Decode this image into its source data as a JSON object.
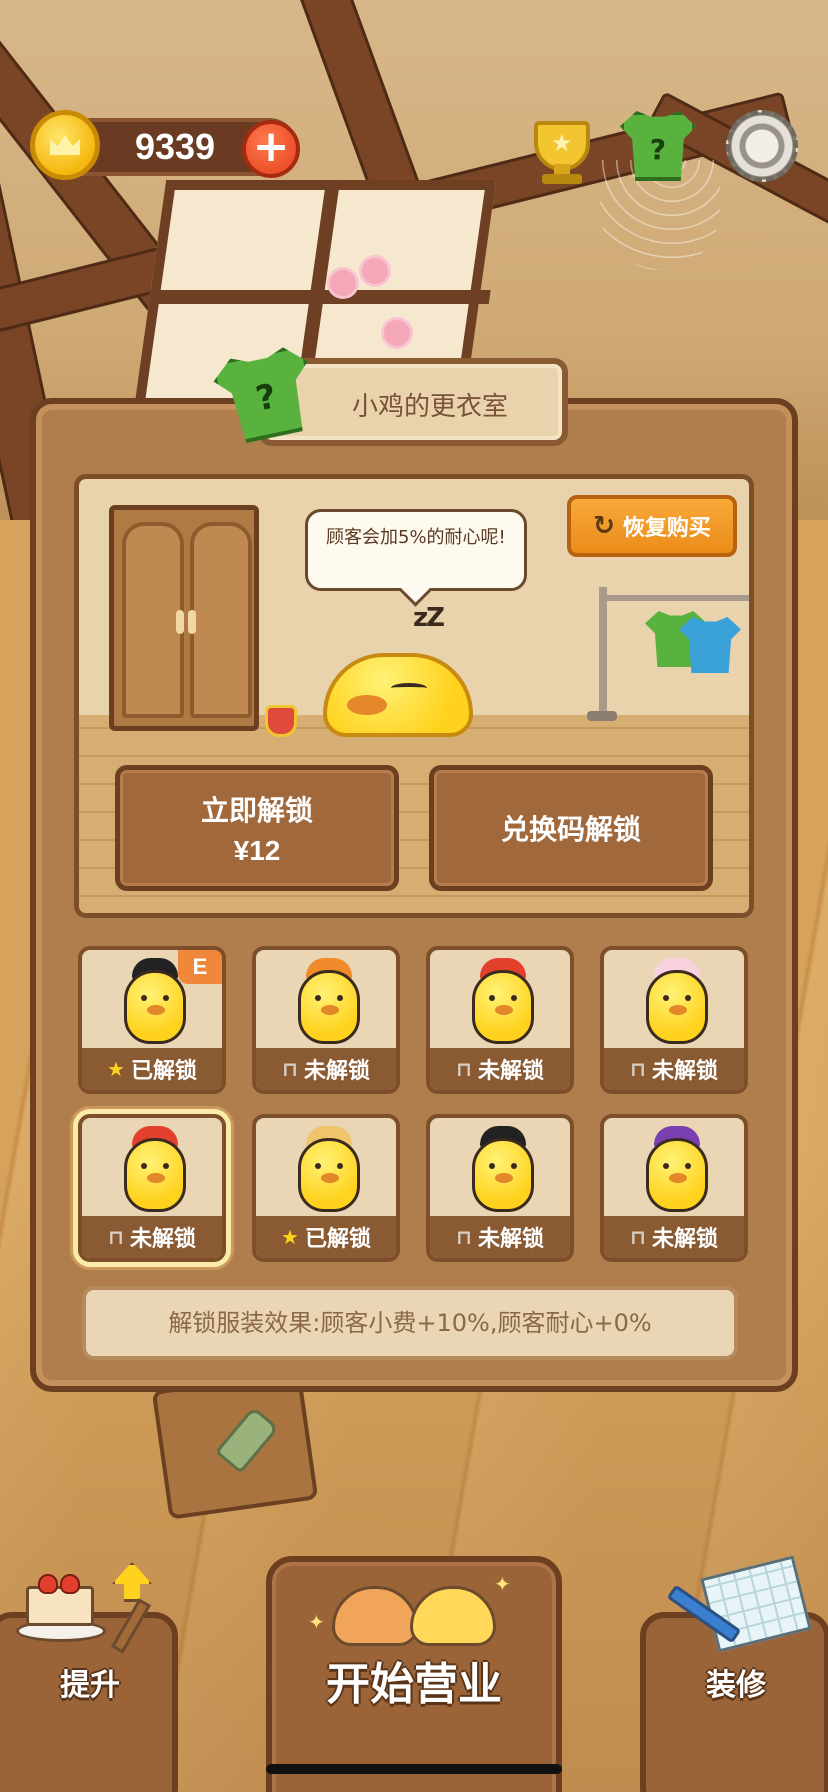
{
  "hud": {
    "coins": "9339",
    "add_label": "+"
  },
  "panel": {
    "title": "小鸡的更衣室",
    "speech": "顾客会加5%的耐心呢!",
    "zzz": "zZ",
    "restore_label": "恢复购买",
    "buy_label": "立即解锁",
    "buy_price": "¥12",
    "code_label": "兑换码解锁"
  },
  "costumes": [
    {
      "status": "已解锁",
      "unlocked": true,
      "badge": "E",
      "hat_color": "#222222",
      "selected": false
    },
    {
      "status": "未解锁",
      "unlocked": false,
      "badge": "",
      "hat_color": "#f08a2a",
      "selected": false
    },
    {
      "status": "未解锁",
      "unlocked": false,
      "badge": "",
      "hat_color": "#e2402c",
      "selected": false
    },
    {
      "status": "未解锁",
      "unlocked": false,
      "badge": "",
      "hat_color": "#f7d2de",
      "selected": false
    },
    {
      "status": "未解锁",
      "unlocked": false,
      "badge": "",
      "hat_color": "#e2402c",
      "selected": true
    },
    {
      "status": "已解锁",
      "unlocked": true,
      "badge": "",
      "hat_color": "#f0c46a",
      "selected": false
    },
    {
      "status": "未解锁",
      "unlocked": false,
      "badge": "",
      "hat_color": "#222222",
      "selected": false
    },
    {
      "status": "未解锁",
      "unlocked": false,
      "badge": "",
      "hat_color": "#7a3fb0",
      "selected": false
    }
  ],
  "effect_text": "解锁服装效果:顾客小费+10%,顾客耐心+0%",
  "nav": {
    "upgrade": "提升",
    "start": "开始营业",
    "decorate": "装修"
  },
  "colors": {
    "accent_orange": "#ec8c1a",
    "wood_dark": "#6b3f20",
    "panel_wood": "#b07e4d",
    "unlocked_star": "#ffd21e"
  }
}
